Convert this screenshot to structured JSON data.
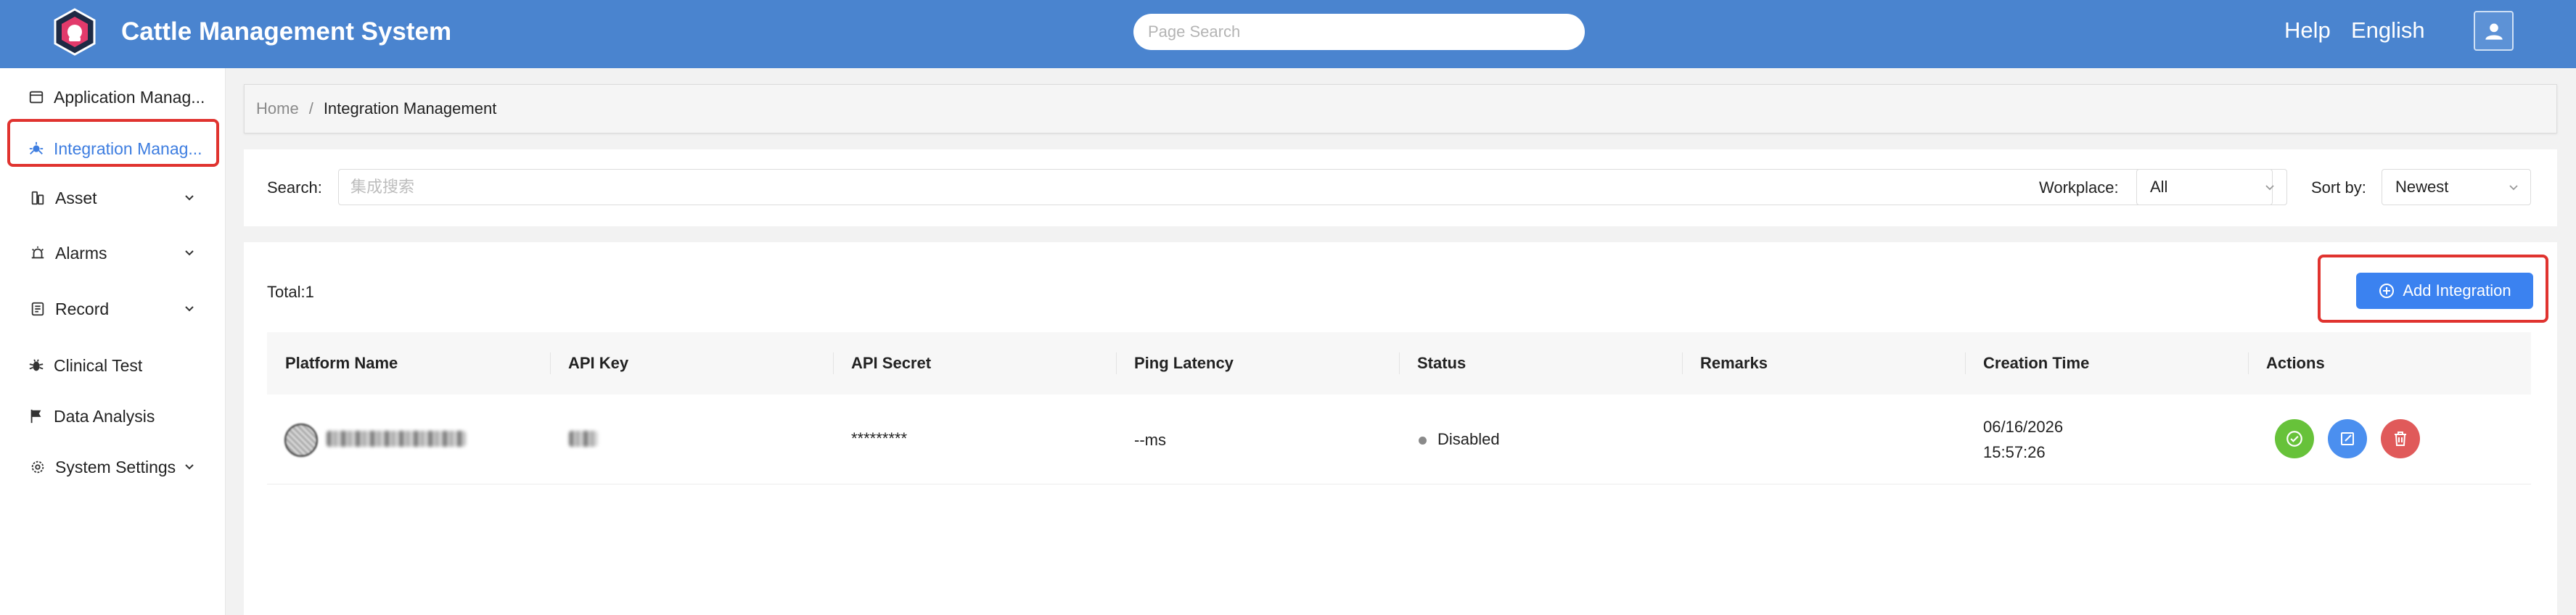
{
  "header": {
    "app_title": "Cattle Management System",
    "search_placeholder": "Page Search",
    "help_label": "Help",
    "language_label": "English"
  },
  "sidebar": {
    "items": [
      {
        "label": "Application Manag...",
        "icon": "app-window-icon",
        "has_chevron": false,
        "active": false
      },
      {
        "label": "Integration Manag...",
        "icon": "integration-icon",
        "has_chevron": false,
        "active": true
      },
      {
        "label": "Asset",
        "icon": "asset-icon",
        "has_chevron": true,
        "active": false
      },
      {
        "label": "Alarms",
        "icon": "alarm-icon",
        "has_chevron": true,
        "active": false
      },
      {
        "label": "Record",
        "icon": "record-icon",
        "has_chevron": true,
        "active": false
      },
      {
        "label": "Clinical Test",
        "icon": "bug-icon",
        "has_chevron": false,
        "active": false
      },
      {
        "label": "Data Analysis",
        "icon": "flag-icon",
        "has_chevron": false,
        "active": false
      },
      {
        "label": "System Settings",
        "icon": "settings-icon",
        "has_chevron": true,
        "active": false
      }
    ]
  },
  "breadcrumb": {
    "home": "Home",
    "separator": "/",
    "current": "Integration Management"
  },
  "filters": {
    "search_label": "Search:",
    "search_placeholder": "集成搜索",
    "workplace_label": "Workplace:",
    "workplace_value": "All",
    "sort_label": "Sort by:",
    "sort_value": "Newest"
  },
  "table": {
    "total_label": "Total:1",
    "add_button_label": "Add Integration",
    "columns": [
      "Platform Name",
      "API Key",
      "API Secret",
      "Ping Latency",
      "Status",
      "Remarks",
      "Creation Time",
      "Actions"
    ],
    "rows": [
      {
        "api_secret": "*********",
        "ping_latency": "--ms",
        "status": "Disabled",
        "remarks": "",
        "creation_date": "06/16/2026",
        "creation_time": "15:57:26"
      }
    ]
  },
  "colors": {
    "header_bg": "#4a84cf",
    "accent": "#3b82f0",
    "highlight": "#e0332f",
    "enable_action": "#67c23a",
    "edit_action": "#4b8fef",
    "delete_action": "#e05a5a"
  }
}
